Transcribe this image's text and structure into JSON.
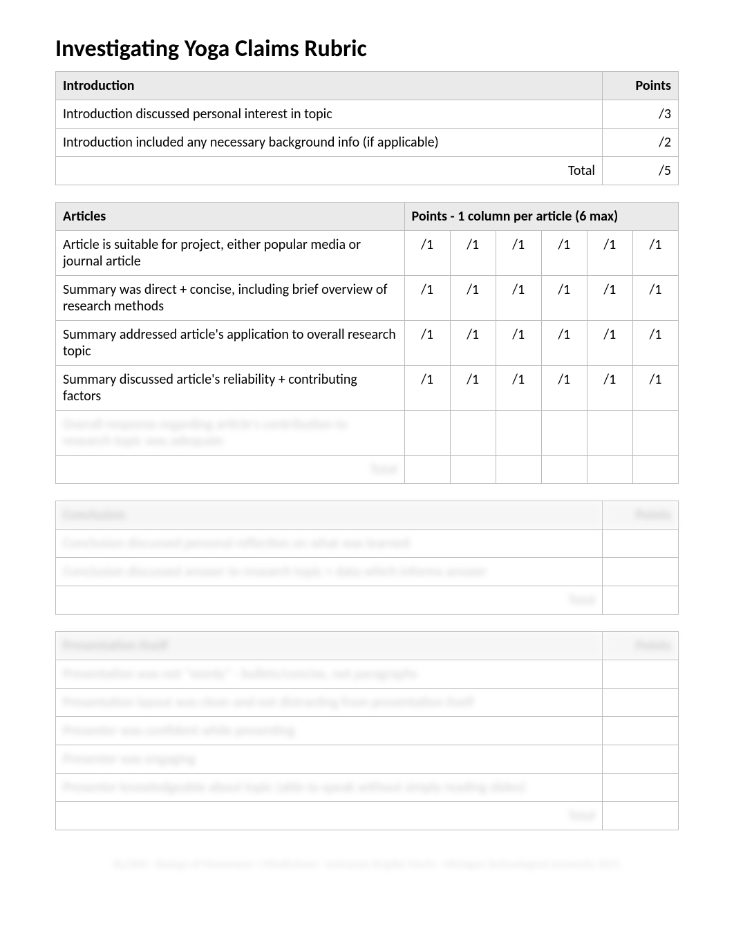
{
  "title": "Investigating Yoga Claims Rubric",
  "section1": {
    "header_label": "Introduction",
    "points_label": "Points",
    "rows": [
      {
        "label": "Introduction discussed personal interest in topic",
        "points": "/3"
      },
      {
        "label": "Introduction included any necessary background info (if applicable)",
        "points": "/2"
      }
    ],
    "total_label": "Total",
    "total_points": "/5"
  },
  "section2": {
    "header_label": "Articles",
    "points_label": "Points - 1 column per article (6 max)",
    "rows": [
      {
        "label": "Article is suitable for project, either popular media or journal article",
        "pts": [
          "/1",
          "/1",
          "/1",
          "/1",
          "/1",
          "/1"
        ]
      },
      {
        "label": "Summary was direct + concise, including brief overview of research methods",
        "pts": [
          "/1",
          "/1",
          "/1",
          "/1",
          "/1",
          "/1"
        ]
      },
      {
        "label": "Summary addressed article's application to overall research topic",
        "pts": [
          "/1",
          "/1",
          "/1",
          "/1",
          "/1",
          "/1"
        ]
      },
      {
        "label": "Summary discussed article's reliability + contributing factors",
        "pts": [
          "/1",
          "/1",
          "/1",
          "/1",
          "/1",
          "/1"
        ]
      }
    ],
    "hidden_row_label": "Overall response regarding article's contribution to research topic was adequate",
    "hidden_total_label": "Total"
  },
  "section3": {
    "header_label": "Conclusion",
    "points_label": "Points",
    "rows": [
      "Conclusion discussed personal reflection on what was learned",
      "Conclusion discussed answer to research topic + data which informs answer"
    ],
    "total_label": "Total"
  },
  "section4": {
    "header_label": "Presentation Itself",
    "points_label": "Points",
    "rows": [
      "Presentation was not \"wordy\" - bullets/concise, not paragraphs",
      "Presentation layout was clean and not distracting from presentation itself",
      "Presenter was confident while presenting",
      "Presenter was engaging",
      "Presenter knowledgeable about topic (able to speak without simply reading slides)"
    ],
    "total_label": "Total"
  },
  "footer": "BL2400 - Biology of Movement + Mindfulness - Instructor Brigitte Morin - Michigan Technological University 2021"
}
